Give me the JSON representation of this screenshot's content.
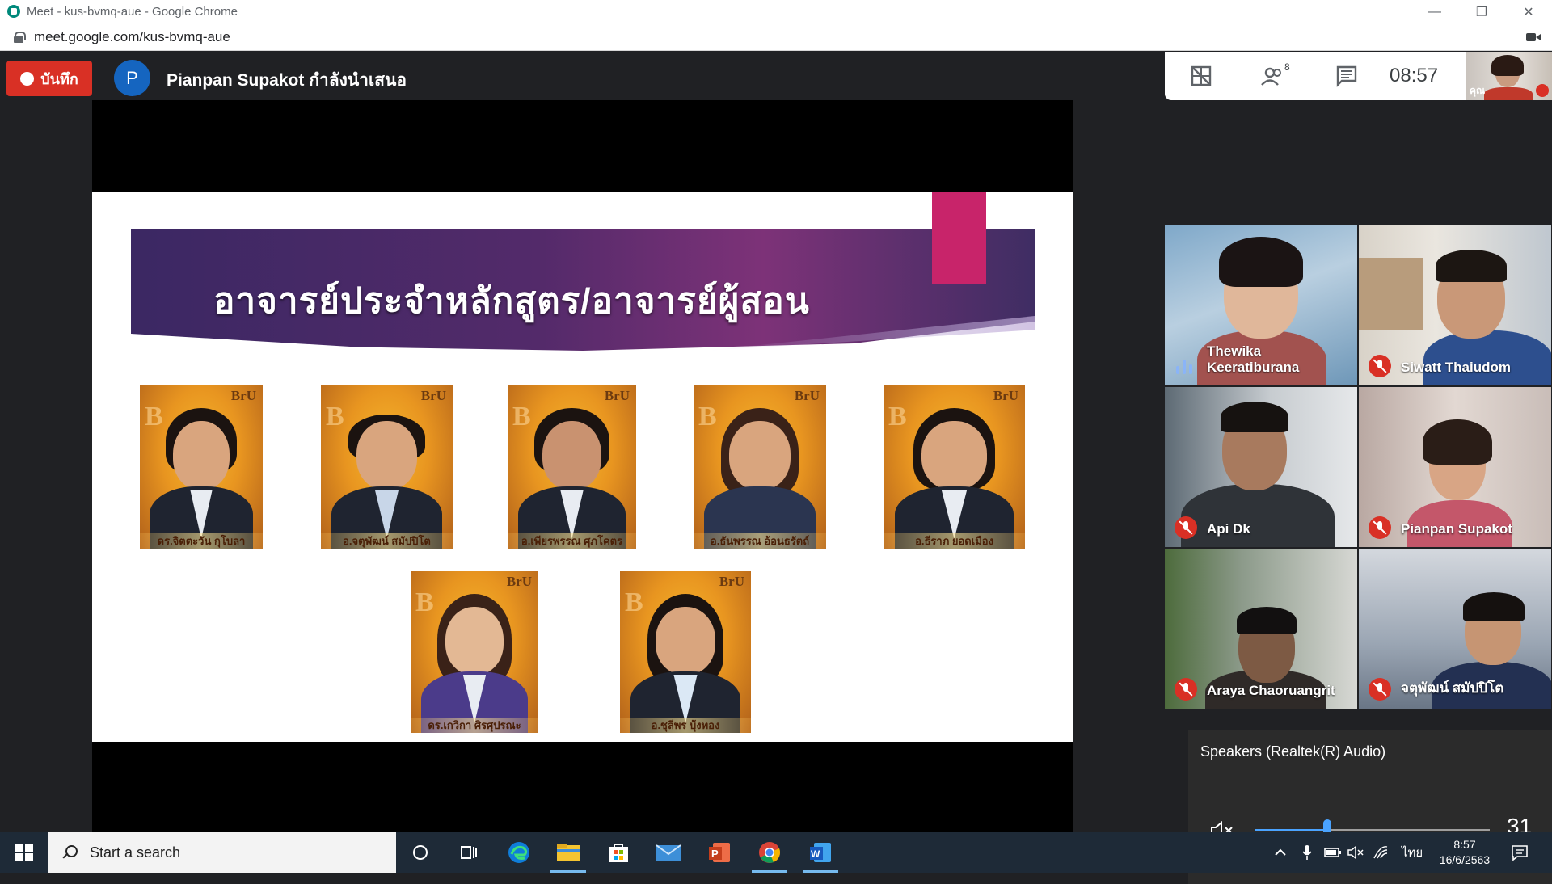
{
  "browser": {
    "window_title": "Meet - kus-bvmq-aue - Google Chrome",
    "url": "meet.google.com/kus-bvmq-aue",
    "controls": [
      "minimize",
      "maximize",
      "close"
    ]
  },
  "meet": {
    "record_label": "บันทึก",
    "presenter_initial": "P",
    "presenter_text": "Pianpan Supakot กำลังนำเสนอ",
    "participants_count": "8",
    "clock": "08:57",
    "self_label": "คุณ",
    "slide": {
      "title": "อาจารย์ประจำหลักสูตร/อาจารย์ผู้สอน",
      "brand": "BrU",
      "photos": [
        {
          "caption": "ดร.จิตตะวัน กุโบลา"
        },
        {
          "caption": "อ.จตุพัฒน์ สมัปปิโต"
        },
        {
          "caption": "อ.เพียรพรรณ ศุภโคตร"
        },
        {
          "caption": "อ.ธันพรรณ อ้อนธรัตถ์"
        },
        {
          "caption": "อ.ธีราภ ยอดเมือง"
        },
        {
          "caption": "ดร.เกวิกา ศิรศุปรณะ"
        },
        {
          "caption": "อ.ชุลีพร บุ้งทอง"
        }
      ]
    },
    "participants": [
      {
        "name": "Thewika Keeratiburana",
        "muted": false
      },
      {
        "name": "Siwatt Thaiudom",
        "muted": true
      },
      {
        "name": "Api Dk",
        "muted": true
      },
      {
        "name": "Pianpan Supakot",
        "muted": true
      },
      {
        "name": "Araya Chaoruangrit",
        "muted": true
      },
      {
        "name": "จตุพัฒน์ สมัปปิโต",
        "muted": true
      }
    ]
  },
  "volume_flyout": {
    "device": "Speakers (Realtek(R) Audio)",
    "value": "31",
    "level": 0.31
  },
  "taskbar": {
    "search_placeholder": "Start a search",
    "pinned": [
      "cortana-icon",
      "task-view-icon",
      "edge-icon",
      "file-explorer-icon",
      "store-icon",
      "mail-icon",
      "powerpoint-icon",
      "chrome-icon",
      "word-icon"
    ],
    "language": "ไทย",
    "time": "8:57",
    "date": "16/6/2563"
  },
  "colors": {
    "record_red": "#d93025",
    "meet_bg": "#202124",
    "accent_blue": "#4aa3ff",
    "slide_pink": "#c8246a",
    "banner_purple": "#532a6a"
  }
}
